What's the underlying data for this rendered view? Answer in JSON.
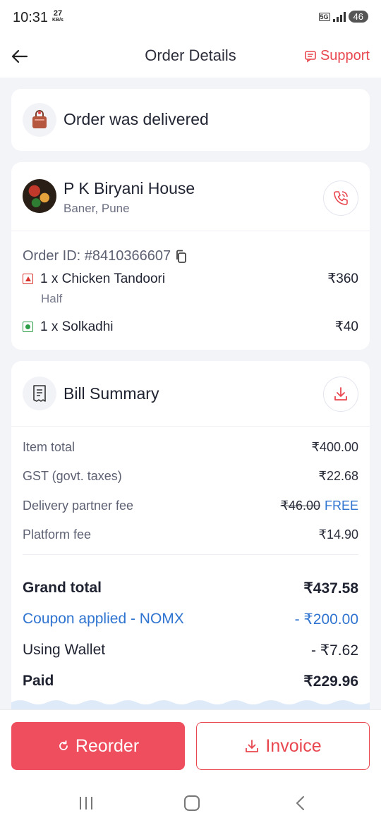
{
  "status_bar": {
    "time": "10:31",
    "speed_value": "27",
    "speed_unit": "KB/s",
    "network": "5G",
    "battery": "46"
  },
  "header": {
    "title": "Order Details",
    "support_label": "Support"
  },
  "order_status": {
    "text": "Order was delivered"
  },
  "restaurant": {
    "name": "P K Biryani House",
    "location": "Baner, Pune",
    "order_id": "Order ID: #8410366607",
    "items": [
      {
        "name": "1 x Chicken Tandoori",
        "variant": "Half",
        "price": "₹360",
        "type": "non-veg"
      },
      {
        "name": "1 x Solkadhi",
        "variant": "",
        "price": "₹40",
        "type": "veg"
      }
    ]
  },
  "bill": {
    "title": "Bill Summary",
    "rows": [
      {
        "label": "Item total",
        "value": "₹400.00"
      },
      {
        "label": "GST (govt. taxes)",
        "value": "₹22.68"
      },
      {
        "label": "Delivery partner fee",
        "original": "₹46.00",
        "value": "FREE"
      },
      {
        "label": "Platform fee",
        "value": "₹14.90"
      }
    ],
    "grand_total": {
      "label": "Grand total",
      "value": "₹437.58"
    },
    "coupon": {
      "label": "Coupon applied - NOMX",
      "value": "- ₹200.00"
    },
    "wallet": {
      "label": "Using Wallet",
      "value": "- ₹7.62"
    },
    "paid": {
      "label": "Paid",
      "value": "₹229.96"
    }
  },
  "actions": {
    "reorder_label": "Reorder",
    "invoice_label": "Invoice"
  },
  "colors": {
    "accent": "#ee4e5d",
    "link_blue": "#2f74d0",
    "veg": "#2e9e4a",
    "nonveg": "#d9322c"
  }
}
